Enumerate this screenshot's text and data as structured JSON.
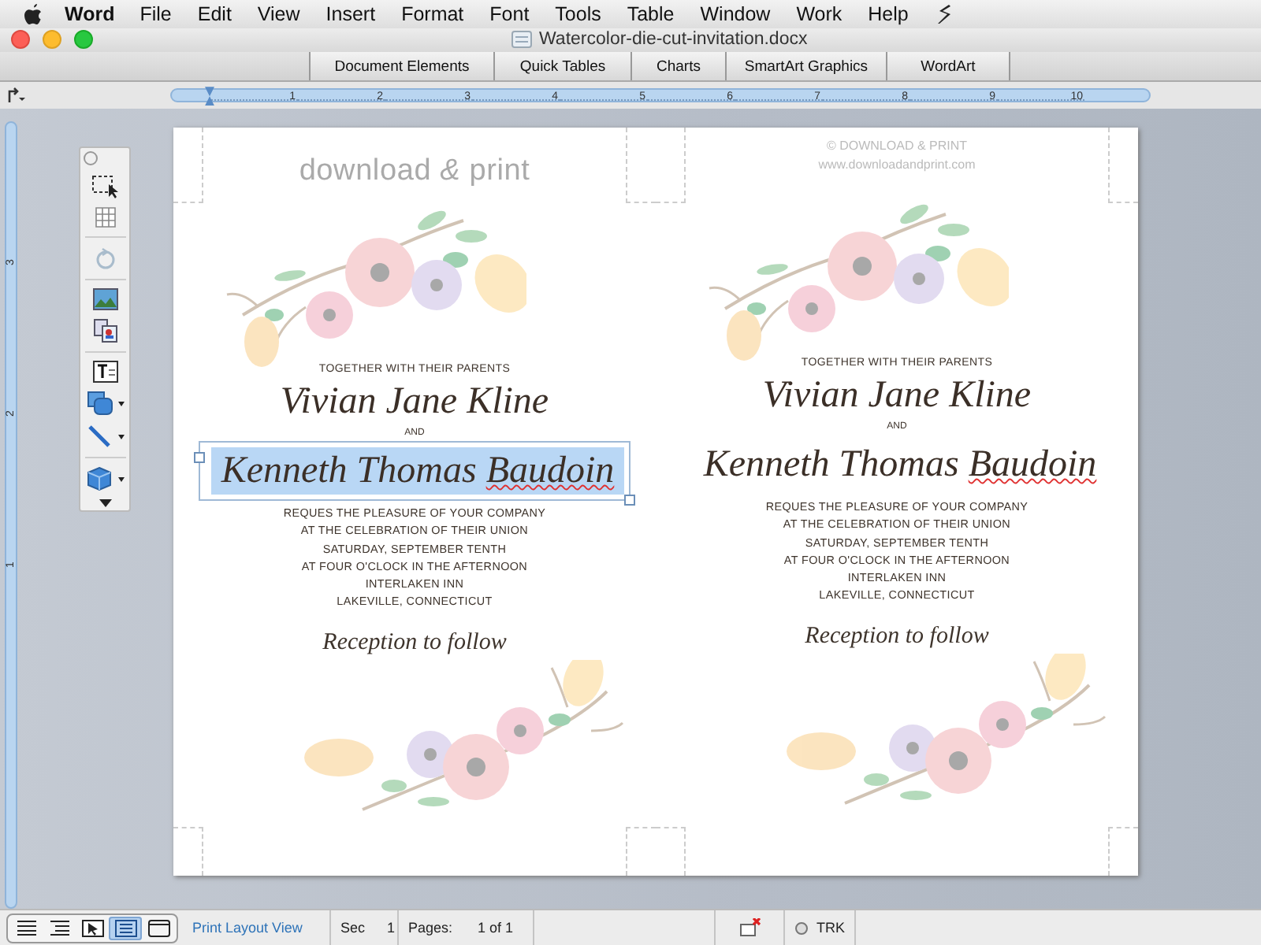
{
  "menu_bar": {
    "app_name": "Word",
    "items": [
      "File",
      "Edit",
      "View",
      "Insert",
      "Format",
      "Font",
      "Tools",
      "Table",
      "Window",
      "Work",
      "Help"
    ]
  },
  "window": {
    "title": "Watercolor-die-cut-invitation.docx"
  },
  "ribbon_tabs": [
    "Document Elements",
    "Quick Tables",
    "Charts",
    "SmartArt Graphics",
    "WordArt"
  ],
  "ruler": {
    "numbers": [
      "1",
      "2",
      "3",
      "4",
      "5",
      "6",
      "7",
      "8",
      "9",
      "10"
    ]
  },
  "vertical_ruler": {
    "numbers": [
      "3",
      "2",
      "1"
    ]
  },
  "document": {
    "panels": [
      {
        "header": {
          "kind": "logo",
          "lines": [
            "download *&* print"
          ]
        },
        "intro": "TOGETHER WITH THEIR PARENTS",
        "name1": "Vivian Jane Kline",
        "conjunction": "AND",
        "name2": {
          "selected": true,
          "parts": [
            {
              "text": "Kenneth Thomas",
              "misspelled": false
            },
            {
              "text": "Baudoin",
              "misspelled": true
            }
          ]
        },
        "details": [
          "REQUES THE PLEASURE OF YOUR COMPANY",
          "AT THE CELEBRATION OF THEIR UNION",
          "SATURDAY, SEPTEMBER TENTH",
          "AT FOUR O'CLOCK IN THE AFTERNOON",
          "INTERLAKEN INN",
          "LAKEVILLE, CONNECTICUT"
        ],
        "reception": "Reception to follow"
      },
      {
        "header": {
          "kind": "credit",
          "lines": [
            "© DOWNLOAD & PRINT",
            "www.downloadandprint.com"
          ]
        },
        "intro": "TOGETHER WITH THEIR PARENTS",
        "name1": "Vivian Jane Kline",
        "conjunction": "AND",
        "name2": {
          "selected": false,
          "parts": [
            {
              "text": "Kenneth Thomas",
              "misspelled": false
            },
            {
              "text": "Baudoin",
              "misspelled": true
            }
          ]
        },
        "details": [
          "REQUES THE PLEASURE OF YOUR COMPANY",
          "AT THE CELEBRATION OF THEIR UNION",
          "SATURDAY, SEPTEMBER TENTH",
          "AT FOUR O'CLOCK IN THE AFTERNOON",
          "INTERLAKEN INN",
          "LAKEVILLE, CONNECTICUT"
        ],
        "reception": "Reception to follow"
      }
    ]
  },
  "status_bar": {
    "view_buttons": [
      {
        "kind": "draft",
        "selected": false
      },
      {
        "kind": "outline",
        "selected": false
      },
      {
        "kind": "publishing",
        "selected": false
      },
      {
        "kind": "print",
        "selected": true
      },
      {
        "kind": "notebook",
        "selected": false
      }
    ],
    "view_name": "Print Layout View",
    "section_label": "Sec",
    "section": "1",
    "pages_label": "Pages:",
    "pages": "1 of 1",
    "track_label": "TRK"
  }
}
